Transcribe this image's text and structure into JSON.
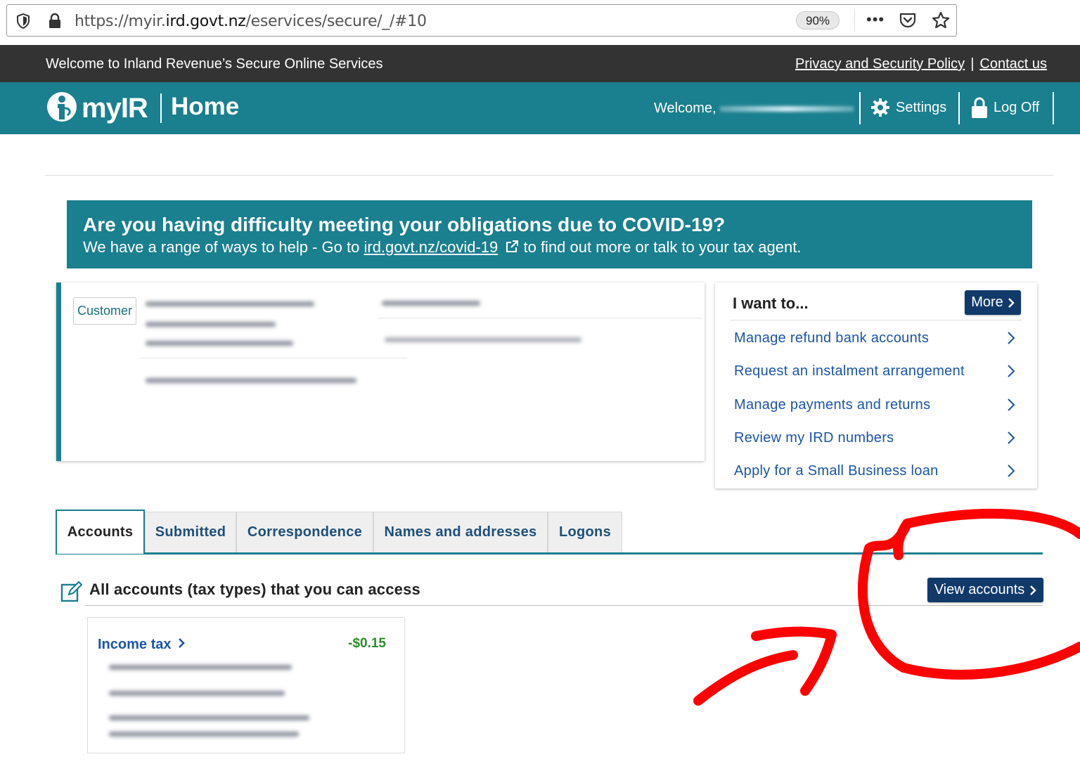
{
  "browser": {
    "url_prefix": "https://myir.",
    "url_domain": "ird.govt.nz",
    "url_path": "/eservices/secure/_/#10",
    "zoom": "90%",
    "menu_glyph": "•••"
  },
  "top_bar": {
    "welcome": "Welcome to Inland Revenue’s Secure Online Services",
    "privacy_link": "Privacy and Security Policy",
    "separator": "|",
    "contact_link": "Contact us"
  },
  "header": {
    "logo_text": "myIR",
    "page_title": "Home",
    "welcome": "Welcome,",
    "settings": "Settings",
    "log_off": "Log Off"
  },
  "covid_banner": {
    "heading": "Are you having difficulty meeting your obligations due to COVID-19?",
    "text_before": "We have a range of ways to help - Go to ",
    "link": "ird.govt.nz/covid-19",
    "text_after": " to find out more or talk to your tax agent."
  },
  "customer": {
    "badge": "Customer"
  },
  "i_want_to": {
    "title": "I want to...",
    "more_button": "More",
    "items": [
      {
        "label": "Manage refund bank accounts"
      },
      {
        "label": "Request an instalment arrangement"
      },
      {
        "label": "Manage payments and returns"
      },
      {
        "label": "Review my IRD numbers"
      },
      {
        "label": "Apply for a Small Business loan"
      }
    ]
  },
  "tabs": [
    {
      "label": "Accounts",
      "active": true
    },
    {
      "label": "Submitted"
    },
    {
      "label": "Correspondence"
    },
    {
      "label": "Names and addresses"
    },
    {
      "label": "Logons"
    }
  ],
  "accounts": {
    "title": "All accounts (tax types) that you can access",
    "view_button": "View accounts",
    "cards": [
      {
        "name": "Income tax",
        "amount": "-$0.15"
      }
    ]
  },
  "colors": {
    "teal": "#1a7f8e",
    "dark_bar": "#333333",
    "navy_button": "#113a6b",
    "link_blue": "#1b55a8",
    "amount_green": "#2e8b2e",
    "annotation_red": "#ff0000"
  }
}
